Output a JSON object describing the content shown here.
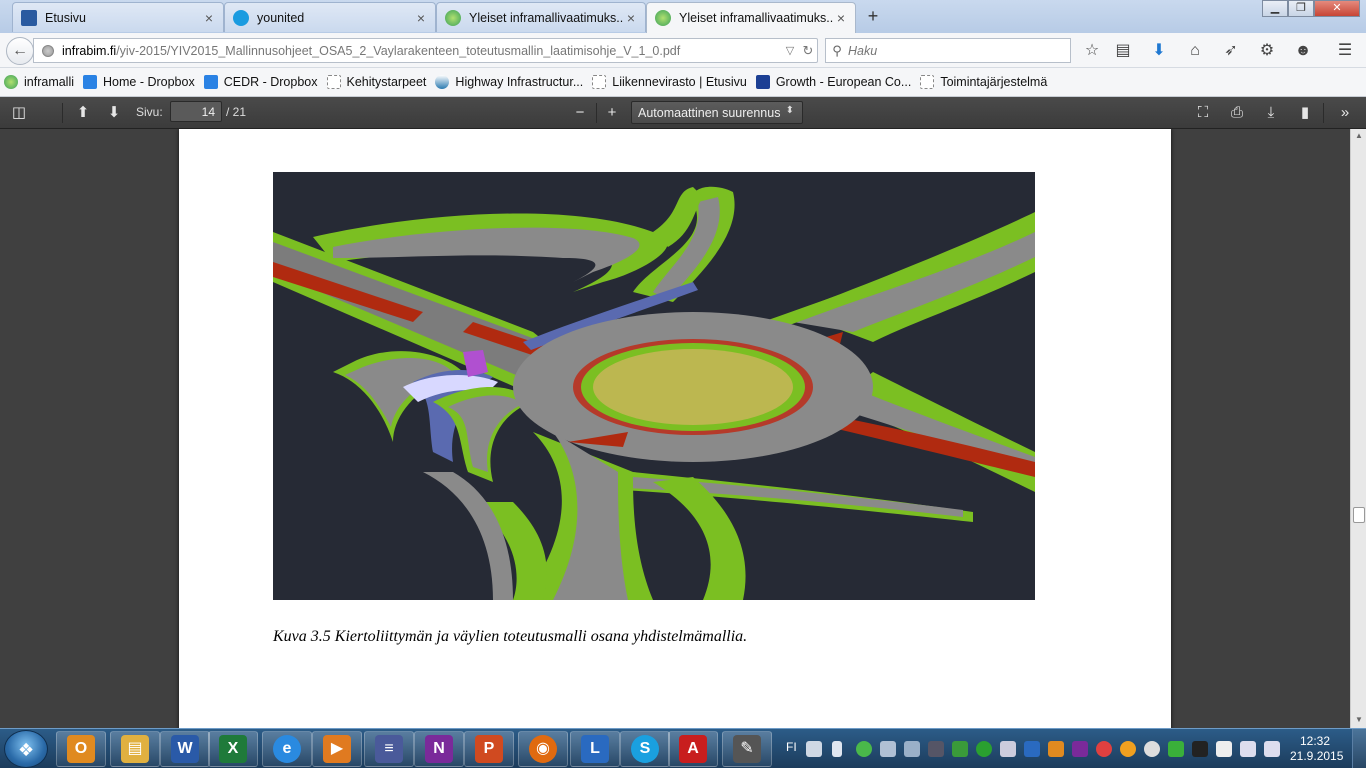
{
  "browser": {
    "tabs": [
      {
        "label": "Etusivu",
        "close": "×",
        "icon": "etusivu-favicon",
        "color": "#2a5aa0"
      },
      {
        "label": "younited",
        "close": "×",
        "icon": "younited-cloud-favicon",
        "color": "#1a9be0"
      },
      {
        "label": "Yleiset inframallivaatimuks...",
        "close": "×",
        "icon": "inframalli-favicon",
        "color": "#3aa05a"
      },
      {
        "label": "Yleiset inframallivaatimuks...",
        "close": "×",
        "icon": "inframalli-favicon",
        "color": "#3aa05a"
      }
    ],
    "new_tab": "+",
    "window_controls": {
      "minimize": "▁",
      "maximize": "❐",
      "close": "✕"
    },
    "url": {
      "domain": "infrabim.fi",
      "path": "/yiv-2015/YIV2015_Mallinnusohjeet_OSA5_2_Vaylarakenteen_toteutusmallin_laatimisohje_V_1_0.pdf"
    },
    "search": {
      "placeholder": "Haku"
    },
    "bookmarks": [
      {
        "label": "inframalli",
        "color": "#3aa05a"
      },
      {
        "label": "Home - Dropbox",
        "color": "#2a82e4"
      },
      {
        "label": "CEDR - Dropbox",
        "color": "#2a82e4"
      },
      {
        "label": "Kehitystarpeet",
        "color": ""
      },
      {
        "label": "Highway Infrastructur...",
        "color": "#2a7ab0"
      },
      {
        "label": "Liikennevirasto | Etusivu",
        "color": ""
      },
      {
        "label": "Growth - European Co...",
        "color": "#1c3f94"
      },
      {
        "label": "Toimintajärjestelmä",
        "color": ""
      }
    ]
  },
  "pdf_viewer": {
    "page_label": "Sivu:",
    "current_page": "14",
    "page_count": "/ 21",
    "zoom_out": "−",
    "zoom_in": "+",
    "zoom_value": "Automaattinen suurennus",
    "caption": "Kuva 3.5 Kiertoliittymän ja väylien toteutusmalli osana yhdistelmämallia."
  },
  "taskbar": {
    "apps": [
      {
        "icon": "outlook-icon",
        "glyph": "O",
        "color": "#e08a20"
      },
      {
        "icon": "file-explorer-icon",
        "glyph": "▤",
        "color": "#e0b040"
      },
      {
        "icon": "word-icon",
        "glyph": "W",
        "color": "#2a5aa8"
      },
      {
        "icon": "excel-icon",
        "glyph": "X",
        "color": "#1f7a3a"
      },
      {
        "icon": "internet-explorer-icon",
        "glyph": "e",
        "color": "#2a8ae0"
      },
      {
        "icon": "media-player-icon",
        "glyph": "▶",
        "color": "#e07a20"
      },
      {
        "icon": "stacked-books-icon",
        "glyph": "≡",
        "color": "#4a5a9a"
      },
      {
        "icon": "onenote-icon",
        "glyph": "N",
        "color": "#7a2a9a"
      },
      {
        "icon": "powerpoint-icon",
        "glyph": "P",
        "color": "#d04a20"
      },
      {
        "icon": "firefox-icon",
        "glyph": "◉",
        "color": "#e06a10"
      },
      {
        "icon": "lync-icon",
        "glyph": "L",
        "color": "#2a6ac0"
      },
      {
        "icon": "skype-icon",
        "glyph": "S",
        "color": "#1aa0e0"
      },
      {
        "icon": "acrobat-icon",
        "glyph": "A",
        "color": "#c81e1e"
      },
      {
        "icon": "notepad-pen-icon",
        "glyph": "✎",
        "color": "#555555"
      }
    ],
    "language": "FI",
    "clock_time": "12:32",
    "clock_date": "21.9.2015"
  }
}
